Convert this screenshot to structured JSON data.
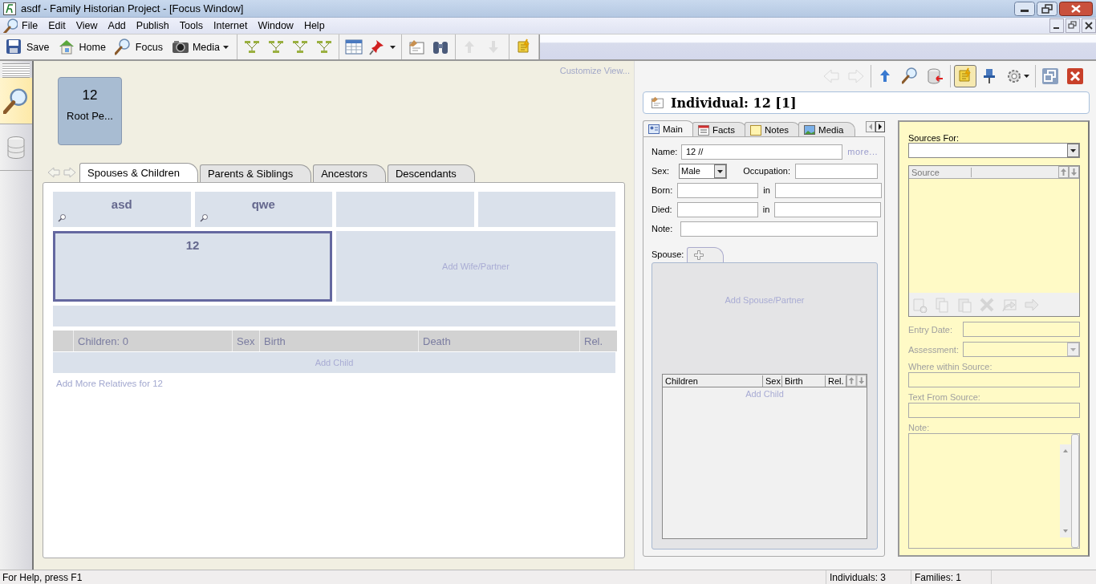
{
  "window": {
    "title": "asdf - Family Historian Project - [Focus Window]"
  },
  "menu": {
    "items": [
      "File",
      "Edit",
      "View",
      "Add",
      "Publish",
      "Tools",
      "Internet",
      "Window",
      "Help"
    ]
  },
  "toolbar": {
    "groups": [
      [
        {
          "label": "Save"
        },
        {
          "label": "Home"
        },
        {
          "label": "Focus"
        },
        {
          "label": "Media",
          "dropdown": true
        }
      ],
      [
        {
          "disabled": false
        },
        {
          "disabled": false
        },
        {
          "disabled": false
        },
        {
          "disabled": false
        }
      ],
      [
        {
          "disabled": false
        },
        {
          "disabled": false,
          "dropdown": true
        }
      ],
      [
        {
          "disabled": false
        },
        {
          "disabled": false
        }
      ],
      [
        {
          "disabled": true
        },
        {
          "disabled": true
        }
      ],
      [
        {
          "disabled": false
        }
      ]
    ]
  },
  "sidebar": {
    "items": [
      {
        "selected": true
      },
      {
        "selected": false
      }
    ]
  },
  "focus": {
    "customize_link": "Customize View...",
    "root_box": {
      "number": "12",
      "label": "Root Pe..."
    },
    "tabs": [
      {
        "label": "Spouses & Children",
        "selected": true
      },
      {
        "label": "Parents & Siblings",
        "selected": false
      },
      {
        "label": "Ancestors",
        "selected": false
      },
      {
        "label": "Descendants",
        "selected": false
      }
    ],
    "parents": [
      {
        "kind": "person",
        "name": "asd"
      },
      {
        "kind": "person",
        "name": "qwe"
      },
      {
        "kind": "empty"
      },
      {
        "kind": "empty"
      }
    ],
    "focus_person": {
      "name": "12",
      "selected": true
    },
    "spouse_placeholder": "Add Wife/Partner",
    "children_table": {
      "columns": [
        "Children: 0",
        "Sex",
        "Birth",
        "Death",
        "Rel."
      ],
      "add_row": "Add Child"
    },
    "add_more_link": "Add More Relatives for 12"
  },
  "property_box": {
    "toolbar": [
      [
        {
          "disabled": true
        },
        {
          "disabled": true
        }
      ],
      [
        {
          "disabled": false
        },
        {
          "disabled": false
        },
        {
          "disabled": false
        }
      ],
      [
        {
          "disabled": false,
          "selected": true
        },
        {
          "disabled": false,
          "selected": false
        },
        {
          "disabled": false,
          "selected": false,
          "dropdown": true
        }
      ],
      [
        {
          "disabled": false
        },
        {
          "disabled": false
        }
      ]
    ],
    "header": "Individual: 12 [1]",
    "tabs": [
      {
        "label": "Main",
        "selected": true
      },
      {
        "label": "Facts",
        "selected": false
      },
      {
        "label": "Notes",
        "selected": false
      },
      {
        "label": "Media",
        "selected": false
      }
    ],
    "form": {
      "name": {
        "label": "Name:",
        "value": "12 //"
      },
      "more_link": "more...",
      "sex": {
        "label": "Sex:",
        "value": "Male"
      },
      "occupation": {
        "label": "Occupation:"
      },
      "born": {
        "label": "Born:",
        "place_label": "in"
      },
      "died": {
        "label": "Died:",
        "place_label": "in"
      },
      "note": {
        "label": "Note:"
      }
    },
    "spouse": {
      "label": "Spouse:",
      "placeholder": "Add Spouse/Partner",
      "children_table": {
        "columns": [
          "Children",
          "Sex",
          "Birth",
          "Rel."
        ],
        "add_row": "Add Child"
      }
    },
    "sources": {
      "label": "Sources For:",
      "list_columns": [
        "Source"
      ],
      "tools": [
        {
          "disabled": true
        },
        {
          "disabled": true
        },
        {
          "disabled": true
        },
        {
          "disabled": true
        },
        {
          "disabled": true
        },
        {
          "disabled": true
        }
      ],
      "fields": [
        {
          "label": "Entry Date:",
          "kind": "inline",
          "disabled": true
        },
        {
          "label": "Assessment:",
          "kind": "select",
          "disabled": true
        },
        {
          "label": "Where within Source:",
          "kind": "stacked",
          "disabled": true
        },
        {
          "label": "Text From Source:",
          "kind": "stacked",
          "disabled": true
        },
        {
          "label": "Note:",
          "kind": "memo",
          "disabled": true
        }
      ]
    }
  },
  "status_bar": {
    "help": "For Help, press F1",
    "individuals": "Individuals: 3",
    "families": "Families: 1"
  }
}
